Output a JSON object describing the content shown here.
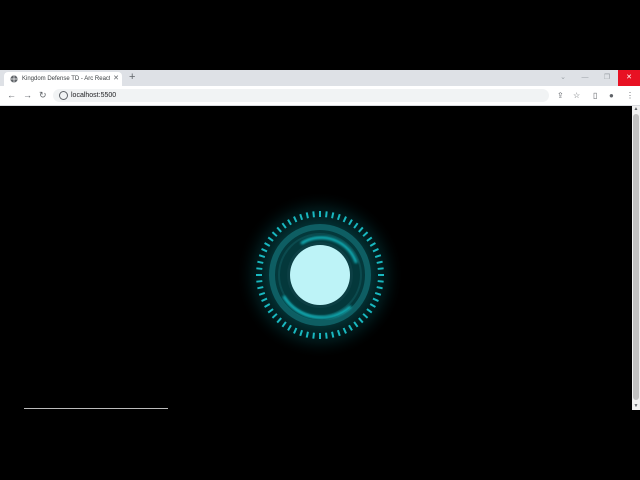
{
  "tab": {
    "title": "Kingdom Defense TD - Arc Reactor",
    "close_icon": "close-icon",
    "favicon": "globe-icon"
  },
  "newtab_label": "+",
  "window_controls": {
    "minimize": "—",
    "restore": "❐",
    "close": "✕"
  },
  "nav": {
    "back": "←",
    "forward": "→",
    "reload": "↻"
  },
  "address_bar": {
    "url": "localhost:5500"
  },
  "toolbar_icons": {
    "share": "⇪",
    "bookmark": "☆",
    "sidepanel": "▯",
    "profile": "●",
    "menu": "⋮"
  },
  "scrollbar": {
    "up": "▲",
    "down": "▼"
  },
  "colors": {
    "glow": "#1fd6d6",
    "core": "#bdf3f7",
    "ring": "#19b8c0"
  }
}
